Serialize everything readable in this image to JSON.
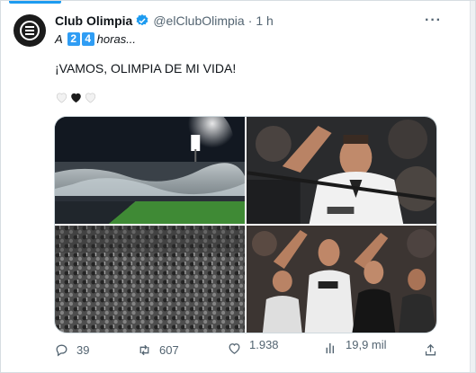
{
  "tweet": {
    "display_name": "Club Olimpia",
    "handle": "@elClubOlimpia",
    "separator": "·",
    "time": "1 h",
    "more": "···",
    "countdown_prefix": "A",
    "countdown_digits": [
      "2",
      "4"
    ],
    "countdown_suffix": "horas...",
    "text": "¡VAMOS, OLIMPIA DE MI VIDA!"
  },
  "photos": [
    {
      "name": "stadium-night-photo"
    },
    {
      "name": "fan-celebrating-photo"
    },
    {
      "name": "crowd-photo"
    },
    {
      "name": "fans-group-photo"
    }
  ],
  "actions": {
    "replies": "39",
    "reposts": "607",
    "likes": "1.938",
    "likes_partial": "",
    "views": "19,9 mil",
    "views_partial": ""
  },
  "colors": {
    "accent": "#1d9bf0",
    "text": "#0f1419",
    "muted": "#536471",
    "countdown_tile": "#2f9df4"
  }
}
